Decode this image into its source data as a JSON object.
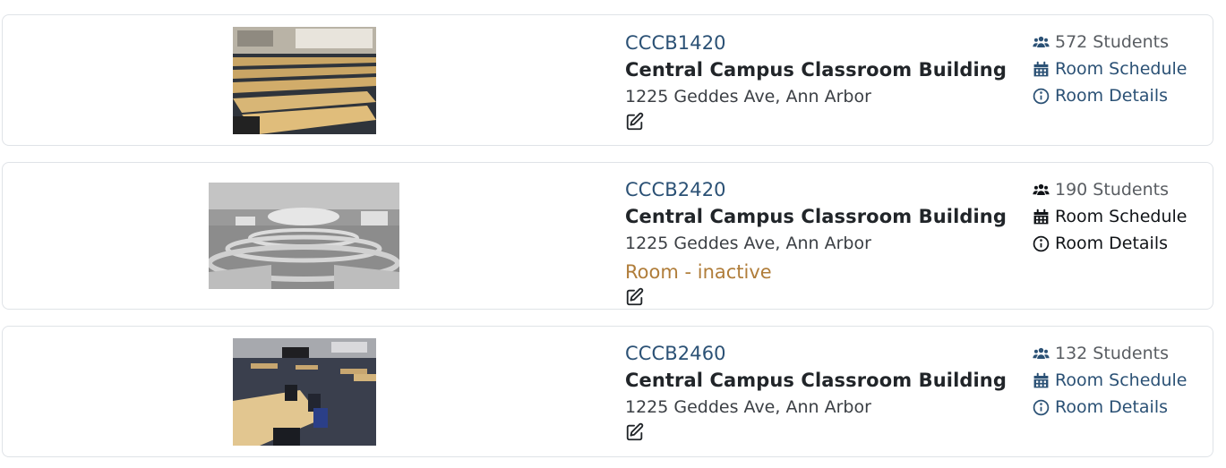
{
  "rooms": [
    {
      "id": "CCCB1420",
      "building": "Central Campus Classroom Building",
      "address": "1225 Geddes Ave, Ann Arbor",
      "capacity": "572 Students",
      "schedule_label": "Room Schedule",
      "details_label": "Room Details"
    },
    {
      "id": "CCCB2420",
      "building": "Central Campus Classroom Building",
      "address": "1225 Geddes Ave, Ann Arbor",
      "status": "Room - inactive",
      "capacity": "190 Students",
      "schedule_label": "Room Schedule",
      "details_label": "Room Details"
    },
    {
      "id": "CCCB2460",
      "building": "Central Campus Classroom Building",
      "address": "1225 Geddes Ave, Ann Arbor",
      "capacity": "132 Students",
      "schedule_label": "Room Schedule",
      "details_label": "Room Details"
    }
  ],
  "colors": {
    "link": "#2b5175",
    "inactive": "#b07d3a",
    "card_border": "#dfe3e7"
  },
  "icons": {
    "capacity": "users-icon",
    "schedule": "calendar-icon",
    "details": "info-circle-icon",
    "edit": "edit-icon"
  }
}
